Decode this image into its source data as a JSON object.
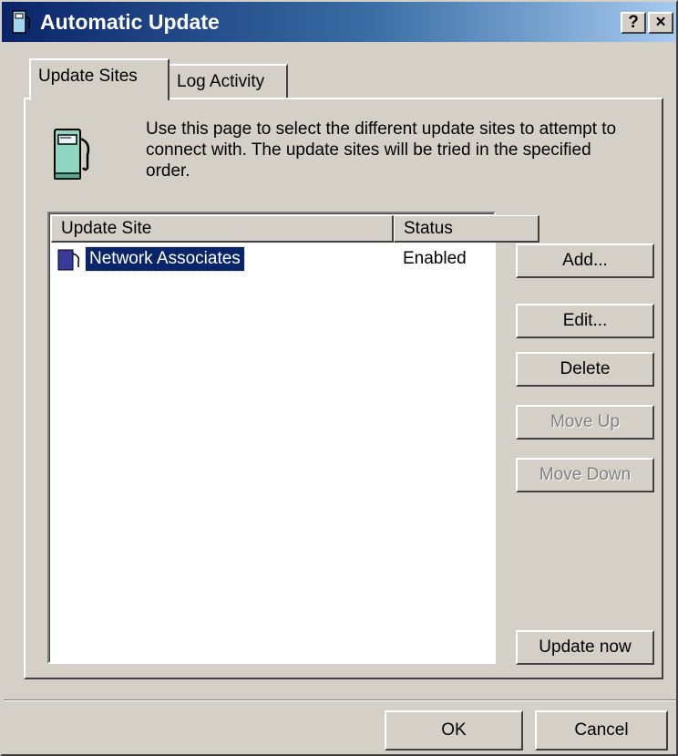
{
  "window": {
    "title": "Automatic Update",
    "help_button": "?",
    "close_button": "×"
  },
  "tabs": [
    {
      "label": "Update Sites",
      "selected": true
    },
    {
      "label": "Log Activity",
      "selected": false
    }
  ],
  "description": "Use this page to select the different update sites to attempt to connect with. The update sites will be tried in the specified order.",
  "list": {
    "columns": [
      "Update Site",
      "Status"
    ],
    "rows": [
      {
        "site": "Network Associates",
        "status": "Enabled",
        "selected": true,
        "icon": "gas-pump-icon"
      }
    ]
  },
  "buttons": {
    "add": "Add...",
    "edit": "Edit...",
    "delete": "Delete",
    "move_up": "Move Up",
    "move_down": "Move Down",
    "update_now": "Update now",
    "ok": "OK",
    "cancel": "Cancel"
  },
  "disabled_buttons": [
    "move_up",
    "move_down"
  ],
  "colors": {
    "dialog_face": "#d4d0c8",
    "titlebar_start": "#0a246a",
    "titlebar_end": "#a6caf0",
    "selection": "#0a246a"
  }
}
